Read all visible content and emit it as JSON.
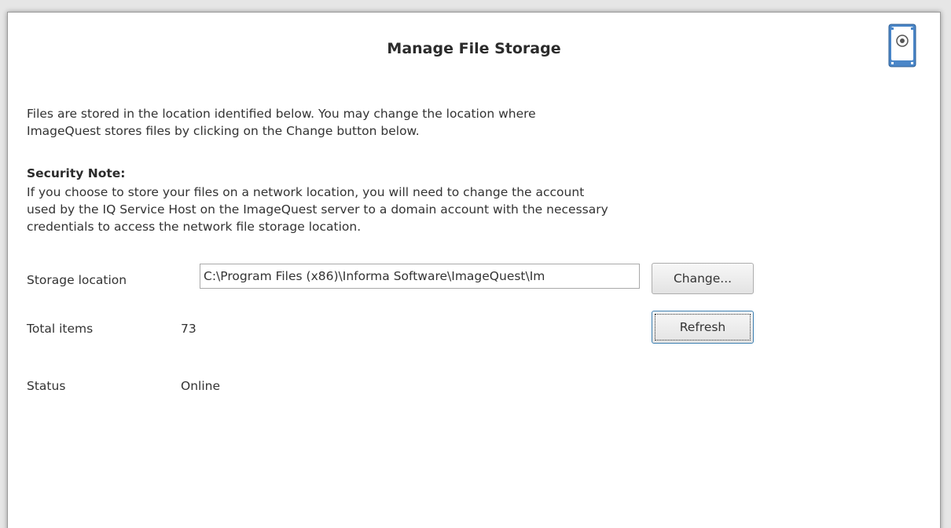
{
  "dialog": {
    "title": "Manage File Storage",
    "icon": "hard-disk-icon",
    "accent_color": "#4a86c8"
  },
  "intro": {
    "line1": "Files are stored in the location identified below.  You may change the location where",
    "line2": "ImageQuest stores files by clicking on the Change button below."
  },
  "security": {
    "heading": "Security Note:",
    "line1": "If you choose to store your files on a network location, you will need to change the account",
    "line2": "used by the IQ Service Host on the ImageQuest server to a domain account with the necessary",
    "line3": "credentials to access the network file storage location."
  },
  "storage": {
    "label": "Storage location",
    "value": "C:\\Program Files (x86)\\Informa Software\\ImageQuest\\Im",
    "change_label": "Change..."
  },
  "total": {
    "label": "Total items",
    "value": "73",
    "refresh_label": "Refresh"
  },
  "status": {
    "label": "Status",
    "value": "Online"
  }
}
